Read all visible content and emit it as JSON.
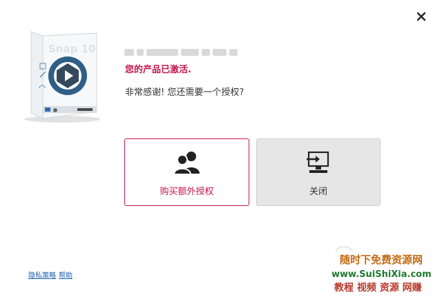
{
  "dialog": {
    "status": "您的产品已激活.",
    "question": "非常感谢! 您还需要一个授权?"
  },
  "product": {
    "box_label": "Snap 10"
  },
  "options": {
    "buy_label": "购买额外授权",
    "close_label": "关闭"
  },
  "footer": {
    "privacy_label": "隐私策略",
    "help_label": "帮助"
  },
  "watermark": {
    "line1": "随时下免费资源网",
    "line2": "www.SuiShiXia.com",
    "line3": "教程 视频 资源 网赚"
  },
  "colors": {
    "accent": "#c4154d",
    "link": "#1a5fb4",
    "close_card_bg": "#e6e6e6"
  },
  "icons": {
    "close": "close-icon",
    "buy": "users-icon",
    "exit": "exit-computer-icon"
  }
}
